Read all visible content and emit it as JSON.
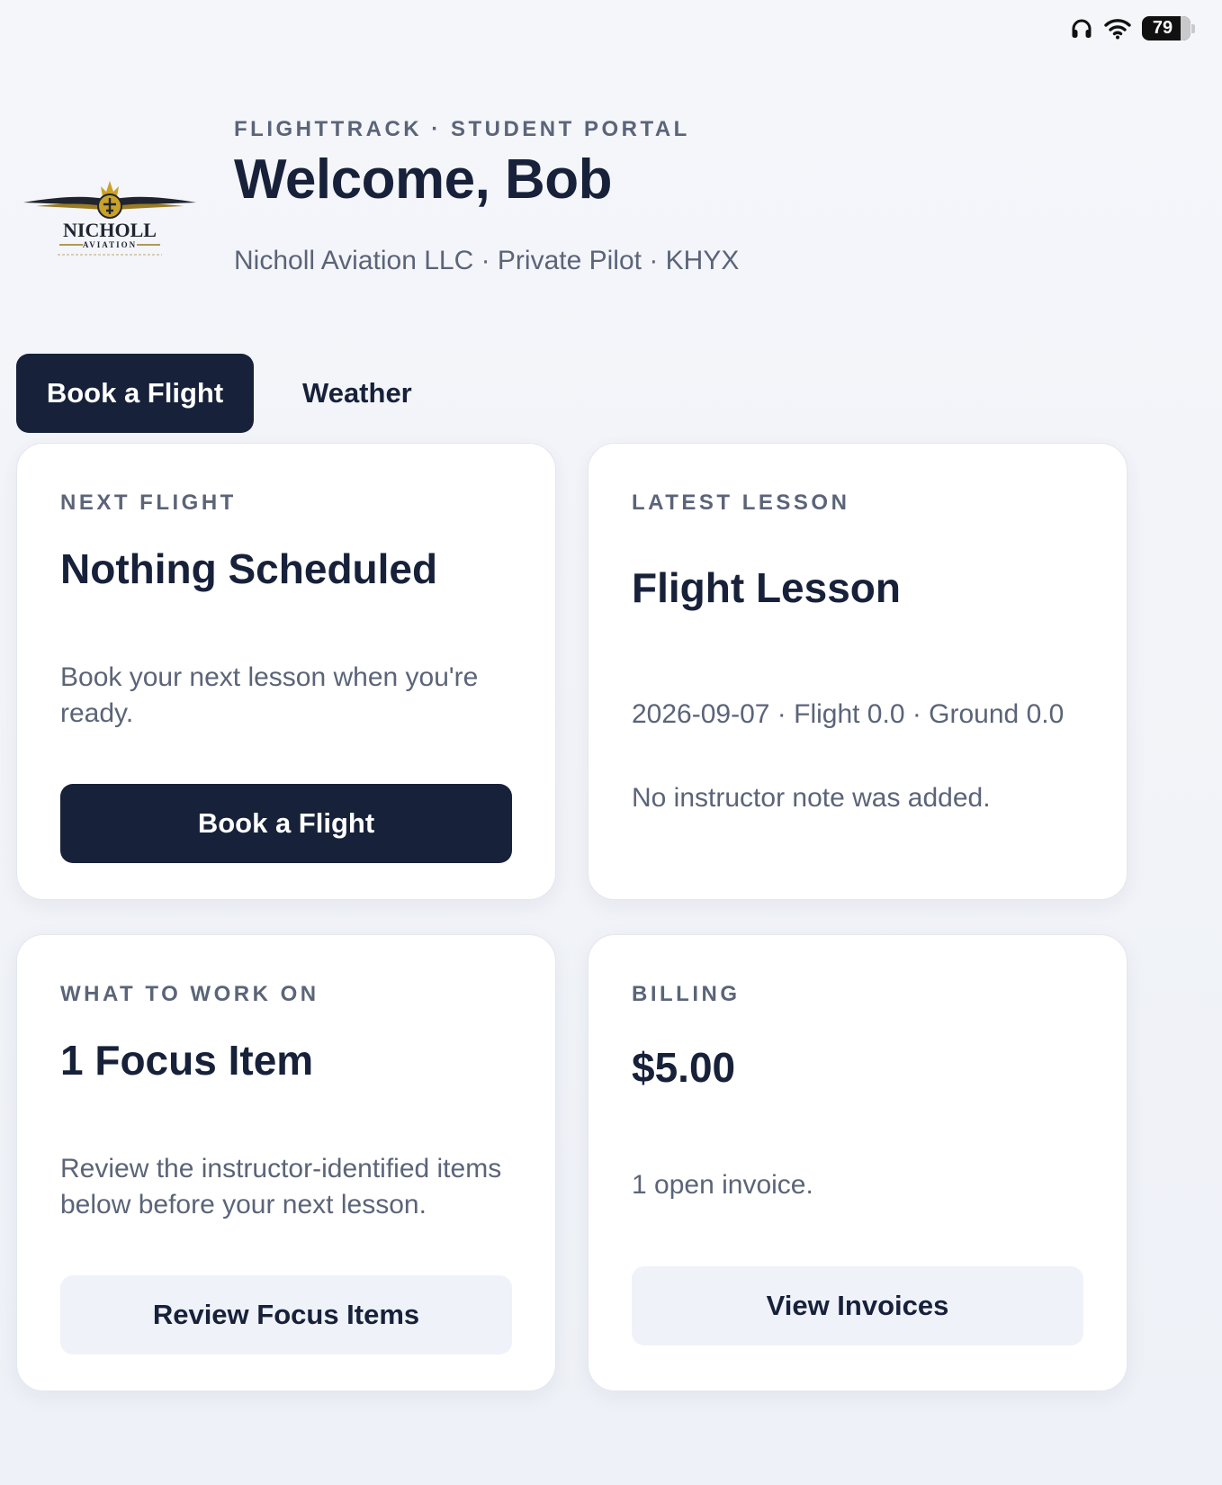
{
  "status_bar": {
    "battery_level": "79",
    "icons": [
      "headphones-icon",
      "wifi-icon",
      "battery-icon"
    ]
  },
  "header": {
    "logo_text": "NICHOLL",
    "logo_subtext": "AVIATION",
    "eyebrow": "FLIGHTTRACK · STUDENT PORTAL",
    "welcome": "Welcome, Bob",
    "subtitle": "Nicholl Aviation LLC · Private Pilot · KHYX"
  },
  "actions": {
    "book_label": "Book a Flight",
    "weather_label": "Weather"
  },
  "cards": {
    "next_flight": {
      "label": "NEXT FLIGHT",
      "title": "Nothing Scheduled",
      "text": "Book your next lesson when you're ready.",
      "button": "Book a Flight"
    },
    "latest_lesson": {
      "label": "LATEST LESSON",
      "title": "Flight Lesson",
      "meta": "2026-09-07 · Flight 0.0 · Ground 0.0",
      "note": "No instructor note was added."
    },
    "work_on": {
      "label": "WHAT TO WORK ON",
      "title": "1 Focus Item",
      "text": "Review the instructor-identified items below before your next lesson.",
      "button": "Review Focus Items"
    },
    "billing": {
      "label": "BILLING",
      "amount": "$5.00",
      "text": "1 open invoice.",
      "button": "View Invoices"
    }
  },
  "colors": {
    "navy": "#17213a",
    "muted": "#5b6478",
    "light_button": "#eff2f8",
    "gold": "#c9a227"
  }
}
